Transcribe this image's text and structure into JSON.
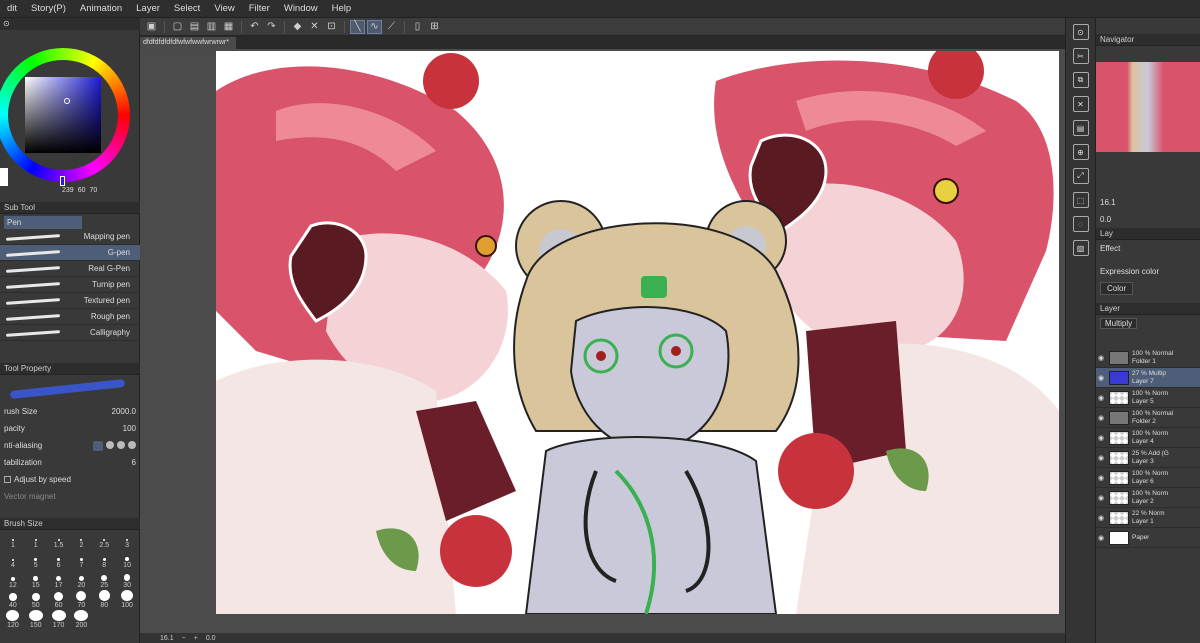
{
  "menu": [
    "dit",
    "Story(P)",
    "Animation",
    "Layer",
    "Select",
    "View",
    "Filter",
    "Window",
    "Help"
  ],
  "document": {
    "tab_title": "dfdfdfdfdfdfwfwfwwfwrwrwr*"
  },
  "color": {
    "value_1": "239",
    "value_2": "60",
    "value_3": "70"
  },
  "subtool": {
    "header": "Sub Tool",
    "group": "Pen",
    "brushes": [
      {
        "name": "Mapping pen",
        "active": false
      },
      {
        "name": "G-pen",
        "active": true
      },
      {
        "name": "Real G-Pen",
        "active": false
      },
      {
        "name": "Turnip pen",
        "active": false
      },
      {
        "name": "Textured pen",
        "active": false
      },
      {
        "name": "Rough pen",
        "active": false
      },
      {
        "name": "Calligraphy",
        "active": false
      }
    ]
  },
  "tool_property": {
    "header": "Tool Property",
    "brush_size_label": "rush Size",
    "brush_size_value": "2000.0",
    "opacity_label": "pacity",
    "opacity_value": "100",
    "antialias_label": "nti-aliasing",
    "stabilization_label": "tabilization",
    "stabilization_value": "6",
    "adjust_speed_label": "Adjust by speed",
    "vector_magnet_label": "Vector magnet"
  },
  "brush_sizes": {
    "header": "Brush Size",
    "sizes": [
      "1",
      "1",
      "1.5",
      "2",
      "2.5",
      "3",
      "4",
      "5",
      "6",
      "7",
      "8",
      "10",
      "12",
      "15",
      "17",
      "20",
      "25",
      "30",
      "40",
      "50",
      "60",
      "70",
      "80",
      "100",
      "120",
      "150",
      "170",
      "200"
    ]
  },
  "status": {
    "zoom": "16.1",
    "rotation": "0.0"
  },
  "navigator": {
    "header": "Navigator",
    "zoom": "16.1",
    "rotation": "0.0"
  },
  "layer_property": {
    "tab": "Lay",
    "effect_label": "Effect",
    "expression_color_label": "Expression color",
    "expression_color_value": "Color"
  },
  "layers_panel": {
    "header": "Layer",
    "blend_mode": "Multiply",
    "layers": [
      {
        "line1": "100 % Normal",
        "line2": "Folder 1",
        "folder": true,
        "active": false
      },
      {
        "line1": "27 % Multip",
        "line2": "Layer 7",
        "folder": false,
        "active": true
      },
      {
        "line1": "100 % Norm",
        "line2": "Layer 5",
        "folder": false,
        "active": false
      },
      {
        "line1": "100 % Normal",
        "line2": "Folder 2",
        "folder": true,
        "active": false
      },
      {
        "line1": "100 % Norm",
        "line2": "Layer 4",
        "folder": false,
        "active": false
      },
      {
        "line1": "25 % Add (G",
        "line2": "Layer 3",
        "folder": false,
        "active": false
      },
      {
        "line1": "100 % Norm",
        "line2": "Layer 6",
        "folder": false,
        "active": false
      },
      {
        "line1": "100 % Norm",
        "line2": "Layer 2",
        "folder": false,
        "active": false
      },
      {
        "line1": "22 % Norm",
        "line2": "Layer 1",
        "folder": false,
        "active": false
      },
      {
        "line1": "Paper",
        "line2": "",
        "folder": false,
        "active": false
      }
    ]
  },
  "colors": {
    "accent": "#4f5e78",
    "panel": "#393939",
    "hair": "#d9536a",
    "bear": "#d9c49b"
  }
}
